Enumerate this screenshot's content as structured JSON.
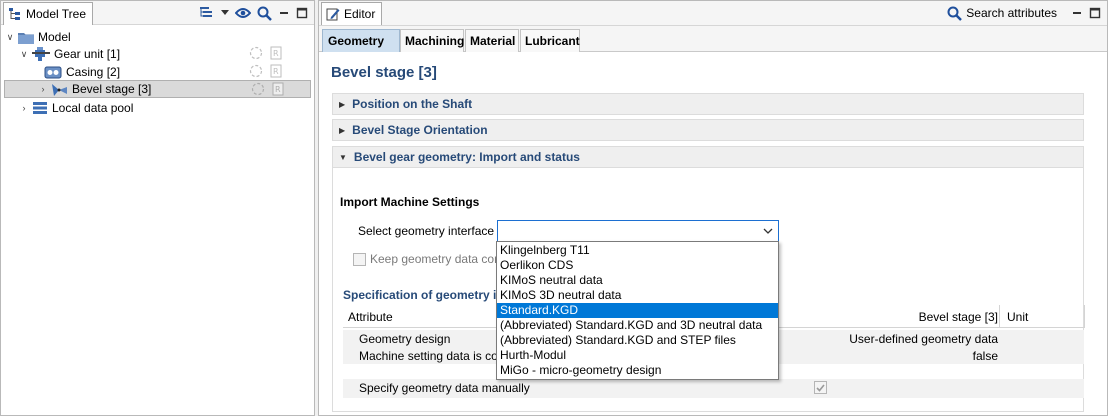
{
  "model_tree": {
    "tab_label": "Model Tree",
    "items": [
      {
        "label": "Model",
        "level": 0,
        "expanded": true,
        "icon": "folder-icon"
      },
      {
        "label": "Gear unit [1]",
        "level": 1,
        "expanded": true,
        "icon": "gear-unit-icon"
      },
      {
        "label": "Casing [2]",
        "level": 2,
        "icon": "casing-icon"
      },
      {
        "label": "Bevel stage [3]",
        "level": 2,
        "selected": true,
        "icon": "bevel-gear-icon"
      },
      {
        "label": "Local data pool",
        "level": 1,
        "icon": "data-pool-icon"
      }
    ]
  },
  "editor": {
    "tab_label": "Editor",
    "search_label": "Search attributes",
    "tabs": [
      "Geometry",
      "Machining",
      "Material",
      "Lubricant"
    ],
    "active_tab": "Geometry",
    "title": "Bevel stage [3]",
    "sections": [
      {
        "label": "Position on the Shaft",
        "expanded": false
      },
      {
        "label": "Bevel Stage Orientation",
        "expanded": false
      },
      {
        "label": "Bevel gear geometry: Import and status",
        "expanded": true
      }
    ],
    "import_title": "Import Machine Settings",
    "select_label": "Select geometry interface",
    "select_value": "",
    "keep_label": "Keep geometry data con",
    "spec_title": "Specification of geometry i",
    "table": {
      "headers": {
        "attribute": "Attribute",
        "value": "Bevel stage [3]",
        "unit": "Unit"
      },
      "rows": [
        {
          "attribute": "Geometry design",
          "value": "User-defined geometry data"
        },
        {
          "attribute": "Machine setting data is co",
          "value": "false"
        },
        {
          "attribute": "Specify geometry data manually",
          "value": ""
        }
      ]
    },
    "dropdown_options": [
      "Klingelnberg T11",
      "Oerlikon CDS",
      "KIMoS neutral data",
      "KIMoS 3D neutral data",
      "Standard.KGD",
      "(Abbreviated) Standard.KGD and 3D neutral data",
      "(Abbreviated) Standard.KGD and STEP files",
      "Hurth-Modul",
      "MiGo - micro-geometry design"
    ],
    "highlighted_option": "Standard.KGD"
  },
  "colors": {
    "accent": "#274a78",
    "selection": "#0078d7",
    "active_tab": "#cfe0f0"
  }
}
